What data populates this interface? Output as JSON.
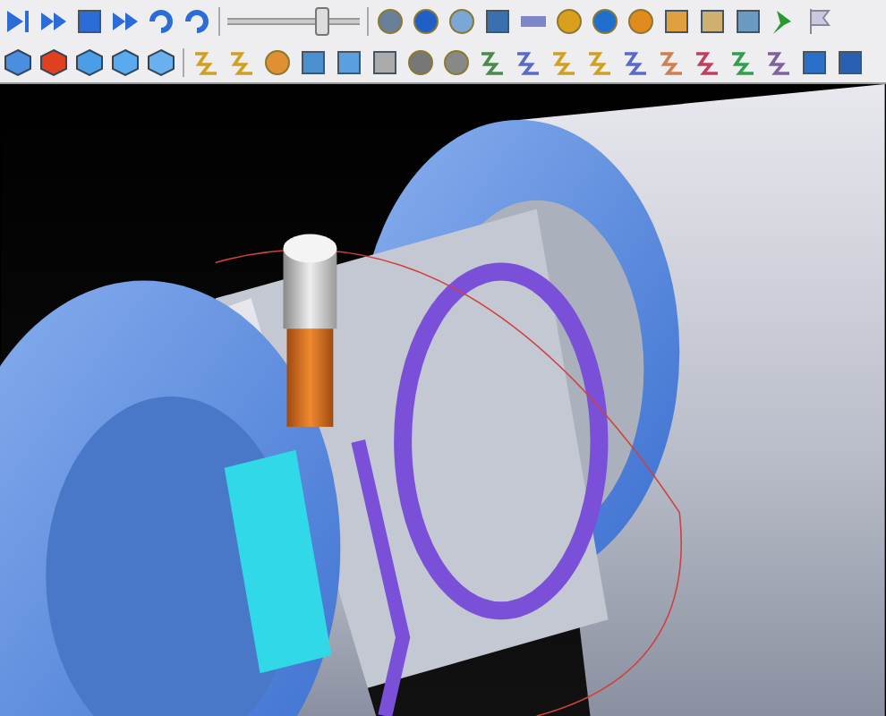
{
  "toolbar": {
    "playback_slider": {
      "level": 0.72
    }
  }
}
